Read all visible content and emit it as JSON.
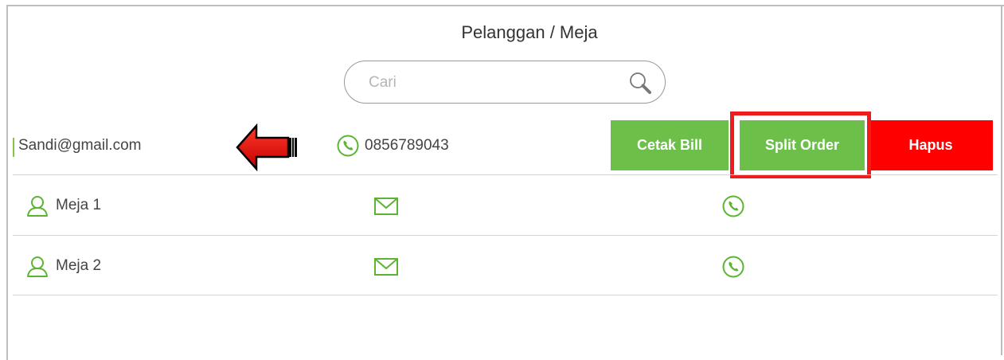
{
  "header": {
    "title": "Pelanggan / Meja"
  },
  "search": {
    "placeholder": "Cari",
    "value": "",
    "icon": "search-icon"
  },
  "selected_customer": {
    "email": "Sandi@gmail.com",
    "phone": "0856789043",
    "actions": {
      "print_bill_label": "Cetak Bill",
      "split_order_label": "Split Order",
      "delete_label": "Hapus"
    }
  },
  "tables": [
    {
      "name": "Meja 1",
      "icons": [
        "user-icon",
        "mail-icon",
        "phone-icon"
      ]
    },
    {
      "name": "Meja 2",
      "icons": [
        "user-icon",
        "mail-icon",
        "phone-icon"
      ]
    }
  ],
  "colors": {
    "accent_green": "#6cc04a",
    "delete_red": "#ff0000",
    "highlight_red": "#ee1c1c",
    "icon_green": "#5cb531"
  }
}
